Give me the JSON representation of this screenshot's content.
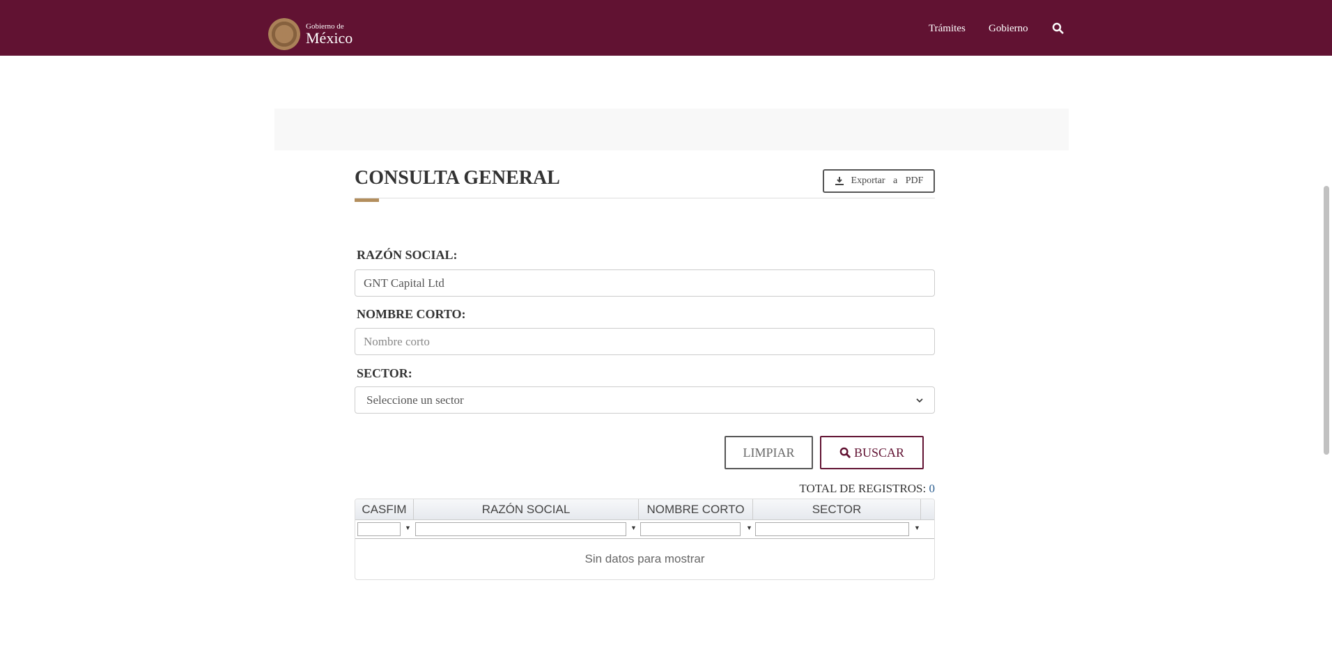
{
  "header": {
    "logo_small": "Gobierno de",
    "logo_big": "México",
    "nav": [
      "Trámites",
      "Gobierno"
    ],
    "brand_color": "#611232",
    "accent_color": "#b38e5d"
  },
  "page": {
    "title": "CONSULTA GENERAL",
    "export_label": "Exportar a PDF"
  },
  "form": {
    "razon_label": "RAZÓN SOCIAL:",
    "razon_value": "GNT Capital Ltd",
    "nombre_label": "NOMBRE CORTO:",
    "nombre_placeholder": "Nombre corto",
    "sector_label": "SECTOR:",
    "sector_value": "Seleccione un sector",
    "clear_label": "LIMPIAR",
    "search_label": "BUSCAR"
  },
  "results": {
    "total_label": "TOTAL DE REGISTROS:",
    "total": "0",
    "columns": [
      "CASFIM",
      "RAZÓN SOCIAL",
      "NOMBRE CORTO",
      "SECTOR"
    ],
    "empty": "Sin datos para mostrar"
  }
}
